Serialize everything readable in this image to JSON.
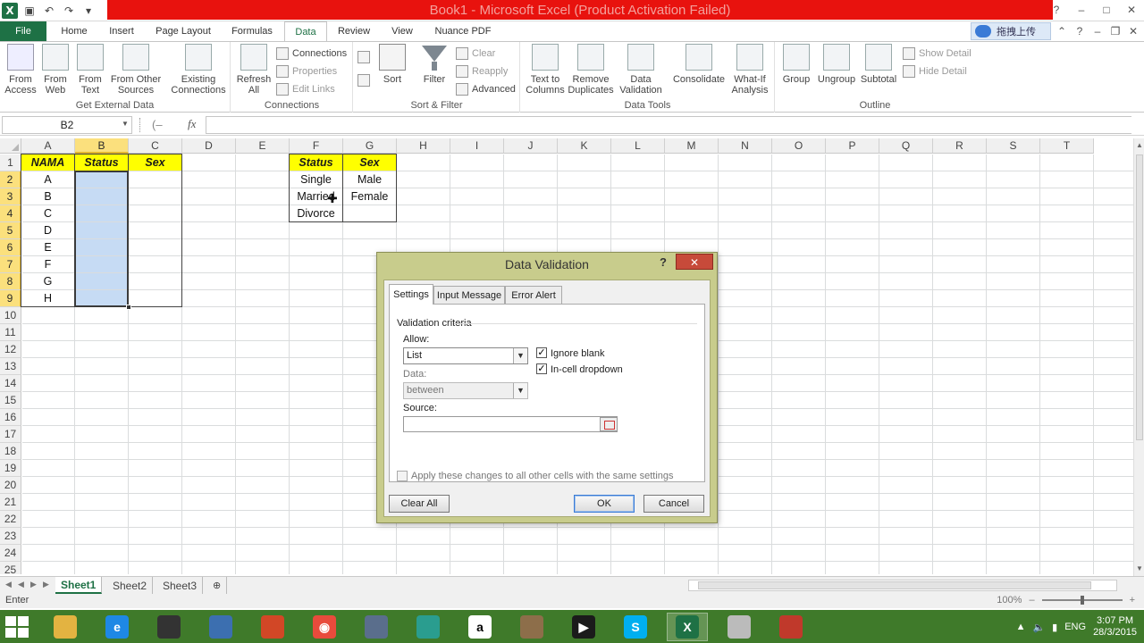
{
  "window": {
    "title": "Book1 - Microsoft Excel (Product Activation Failed)",
    "controls": [
      "?",
      "–",
      "□",
      "✕"
    ]
  },
  "ribbon_tabs": [
    "File",
    "Home",
    "Insert",
    "Page Layout",
    "Formulas",
    "Data",
    "Review",
    "View",
    "Nuance PDF"
  ],
  "active_tab": "Data",
  "upload_button": "拖拽上传",
  "ribbon": {
    "groups": {
      "get_external": "Get External Data",
      "connections": "Connections",
      "sort_filter": "Sort & Filter",
      "data_tools": "Data Tools",
      "outline": "Outline"
    },
    "buttons": {
      "from_access": [
        "From",
        "Access"
      ],
      "from_web": [
        "From",
        "Web"
      ],
      "from_text": [
        "From",
        "Text"
      ],
      "from_other": [
        "From Other",
        "Sources"
      ],
      "existing": [
        "Existing",
        "Connections"
      ],
      "refresh": [
        "Refresh",
        "All"
      ],
      "connections": "Connections",
      "properties": "Properties",
      "edit_links": "Edit Links",
      "sort": "Sort",
      "filter": "Filter",
      "clear": "Clear",
      "reapply": "Reapply",
      "advanced": "Advanced",
      "text_to_columns": [
        "Text to",
        "Columns"
      ],
      "remove_duplicates": [
        "Remove",
        "Duplicates"
      ],
      "data_validation": [
        "Data",
        "Validation"
      ],
      "consolidate": "Consolidate",
      "what_if": [
        "What-If",
        "Analysis"
      ],
      "group": "Group",
      "ungroup": "Ungroup",
      "subtotal": "Subtotal",
      "show_detail": "Show Detail",
      "hide_detail": "Hide Detail"
    }
  },
  "formula_bar": {
    "name_box": "B2",
    "fx": "fx",
    "value": ""
  },
  "columns": [
    "A",
    "B",
    "C",
    "D",
    "E",
    "F",
    "G",
    "H",
    "I",
    "J",
    "K",
    "L",
    "M",
    "N",
    "O",
    "P",
    "Q",
    "R",
    "S",
    "T"
  ],
  "rows": [
    "1",
    "2",
    "3",
    "4",
    "5",
    "6",
    "7",
    "8",
    "9",
    "10",
    "11",
    "12",
    "13",
    "14",
    "15",
    "16",
    "17",
    "18",
    "19",
    "20",
    "21",
    "22",
    "23",
    "24",
    "25"
  ],
  "table1": {
    "headers": [
      "NAMA",
      "Status",
      "Sex"
    ],
    "names": [
      "A",
      "B",
      "C",
      "D",
      "E",
      "F",
      "G",
      "H"
    ]
  },
  "table2": {
    "headers": [
      "Status",
      "Sex"
    ],
    "status": [
      "Single",
      "Married",
      "Divorce"
    ],
    "sex": [
      "Male",
      "Female"
    ]
  },
  "sheets": [
    "Sheet1",
    "Sheet2",
    "Sheet3"
  ],
  "active_sheet": "Sheet1",
  "status_bar": {
    "mode": "Enter",
    "zoom": "100%"
  },
  "dialog": {
    "title": "Data Validation",
    "help": "?",
    "close": "✕",
    "tabs": [
      "Settings",
      "Input Message",
      "Error Alert"
    ],
    "active_tab": "Settings",
    "validation_criteria": "Validation criteria",
    "allow_label": "Allow:",
    "allow_value": "List",
    "data_label": "Data:",
    "data_value": "between",
    "ignore_blank": "Ignore blank",
    "ignore_blank_checked": true,
    "in_cell_dropdown": "In-cell dropdown",
    "in_cell_dropdown_checked": true,
    "source_label": "Source:",
    "source_value": "",
    "apply_all": "Apply these changes to all other cells with the same settings",
    "apply_all_checked": false,
    "clear_all": "Clear All",
    "ok": "OK",
    "cancel": "Cancel"
  },
  "taskbar": {
    "apps": [
      "file-explorer",
      "internet-explorer",
      "media-player",
      "control-panel",
      "powerpoint",
      "chrome",
      "pdf-reader",
      "search-tool",
      "amazon",
      "archive",
      "video-player",
      "skype",
      "excel",
      "notes",
      "recorder"
    ],
    "active_app": "excel",
    "language": "ENG",
    "time": "3:07 PM",
    "date": "28/3/2015"
  },
  "colors": {
    "excel_green": "#1e7145",
    "title_red": "#e8120e",
    "header_yellow": "#ffff00",
    "selection_blue": "#c6dbf4",
    "dialog_frame": "#c8cc8c",
    "taskbar": "#3f7a2a"
  }
}
